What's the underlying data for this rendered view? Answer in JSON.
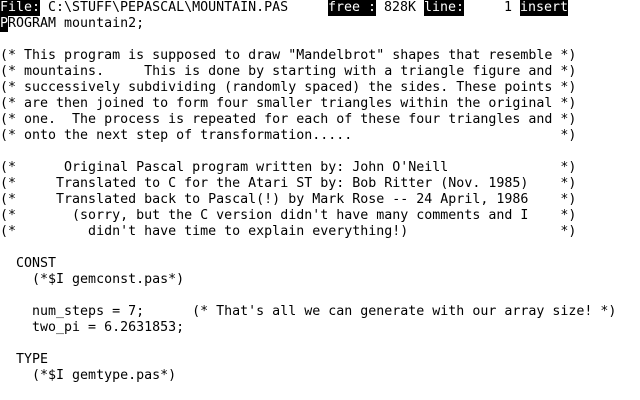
{
  "status": {
    "file_label": "File:",
    "file_path": "C:\\STUFF\\PEPASCAL\\MOUNTAIN.PAS",
    "free_label": "free :",
    "free_value": "828K",
    "line_label": "line:",
    "line_value": "1",
    "mode": "insert"
  },
  "cursor": {
    "char": "P"
  },
  "editor": {
    "lines": [
      "PROGRAM mountain2;",
      "",
      "(* This program is supposed to draw \"Mandelbrot\" shapes that resemble *)",
      "(* mountains.     This is done by starting with a triangle figure and *)",
      "(* successively subdividing (randomly spaced) the sides. These points *)",
      "(* are then joined to form four smaller triangles within the original *)",
      "(* one.  The process is repeated for each of these four triangles and *)",
      "(* onto the next step of transformation.....                          *)",
      "",
      "(*      Original Pascal program written by: John O'Neill              *)",
      "(*     Translated to C for the Atari ST by: Bob Ritter (Nov. 1985)    *)",
      "(*     Translated back to Pascal(!) by Mark Rose -- 24 April, 1986    *)",
      "(*       (sorry, but the C version didn't have many comments and I    *)",
      "(*         didn't have time to explain everything!)                   *)",
      "",
      "  CONST",
      "    (*$I gemconst.pas*)",
      "",
      "    num_steps = 7;      (* That's all we can generate with our array size! *)",
      "    two_pi = 6.2631853;",
      "",
      "  TYPE",
      "    (*$I gemtype.pas*)",
      ""
    ]
  }
}
